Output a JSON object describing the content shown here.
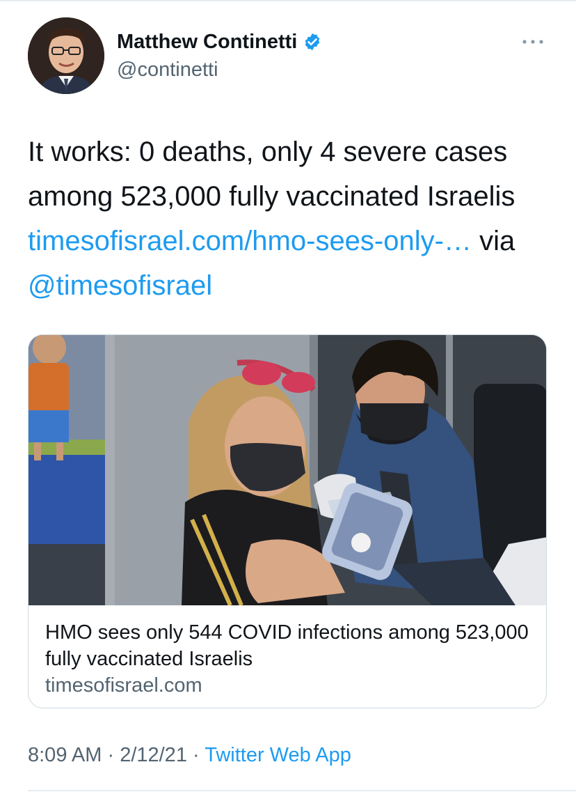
{
  "author": {
    "display_name": "Matthew Continetti",
    "handle": "@continetti",
    "verified": true,
    "avatar_icon": "profile-photo"
  },
  "more_icon": "ellipsis-icon",
  "tweet": {
    "text_prefix": "It works: 0 deaths, only 4 severe cases among 523,000 fully vaccinated Israelis ",
    "link_text": "timesofisrael.com/hmo-sees-only-…",
    "via_text": " via ",
    "mention": "@timesofisrael"
  },
  "card": {
    "title": "HMO sees only 544 COVID infections among 523,000 fully vaccinated Israelis",
    "domain": "timesofisrael.com"
  },
  "meta": {
    "time": "8:09 AM",
    "separator": " · ",
    "date": "2/12/21",
    "source": "Twitter Web App"
  },
  "colors": {
    "link": "#1d9bf0",
    "secondary_text": "#536471",
    "primary_text": "#0f1419",
    "border": "#cfd9de"
  }
}
